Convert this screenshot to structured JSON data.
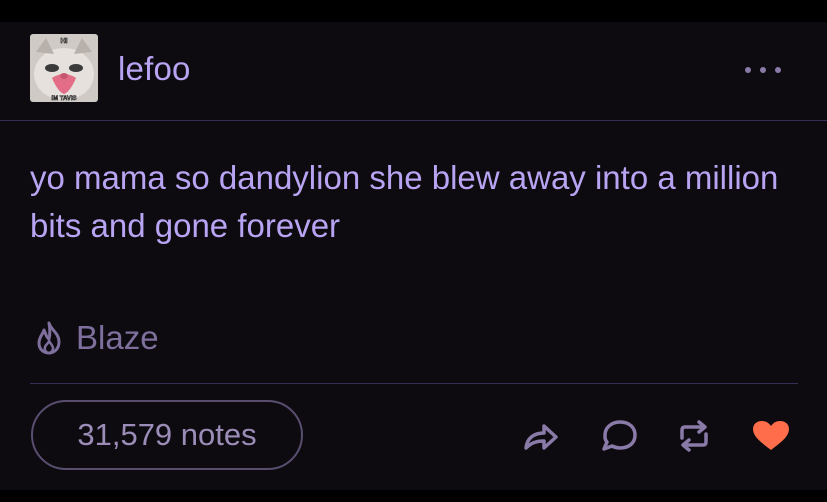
{
  "post": {
    "username": "lefoo",
    "avatar_caption_top": "HI",
    "avatar_caption_bottom": "IM TAVIS",
    "body": "yo mama so dandylion she blew away into a million bits and gone forever",
    "blaze_label": "Blaze",
    "notes_label": "31,579 notes"
  },
  "icons": {
    "more": "more-dots-icon",
    "blaze": "flame-icon",
    "share": "share-arrow-icon",
    "reply": "speech-bubble-icon",
    "reblog": "reblog-icon",
    "like": "heart-icon"
  },
  "colors": {
    "accent_text": "#b9a4f3",
    "muted_text": "#7e6f9c",
    "like_active": "#ff6d4a"
  }
}
